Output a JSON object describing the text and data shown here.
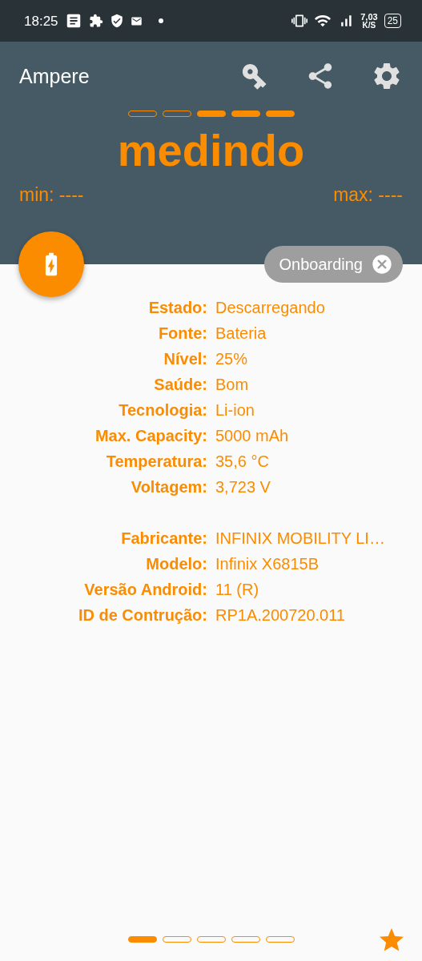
{
  "status_bar": {
    "time": "18:25",
    "speed": "7,03",
    "speed_unit": "K/S",
    "battery": "25"
  },
  "app_bar": {
    "title": "Ampere"
  },
  "meter": {
    "segments": [
      {
        "filled": false
      },
      {
        "filled": false
      },
      {
        "filled": true
      },
      {
        "filled": true
      },
      {
        "filled": true
      }
    ],
    "reading": "medindo",
    "min": "min: ----",
    "max": "max: ----"
  },
  "chip": {
    "label": "Onboarding"
  },
  "info_groups": [
    [
      {
        "label": "Estado:",
        "value": "Descarregando"
      },
      {
        "label": "Fonte:",
        "value": "Bateria"
      },
      {
        "label": "Nível:",
        "value": "25%"
      },
      {
        "label": "Saúde:",
        "value": "Bom"
      },
      {
        "label": "Tecnologia:",
        "value": "Li-ion"
      },
      {
        "label": "Max. Capacity:",
        "value": "5000 mAh"
      },
      {
        "label": "Temperatura:",
        "value": "35,6 °C"
      },
      {
        "label": "Voltagem:",
        "value": "3,723 V"
      }
    ],
    [
      {
        "label": "Fabricante:",
        "value": "INFINIX MOBILITY LI…"
      },
      {
        "label": "Modelo:",
        "value": "Infinix X6815B"
      },
      {
        "label": "Versão Android:",
        "value": "11 (R)"
      },
      {
        "label": "ID de Contrução:",
        "value": "RP1A.200720.011"
      }
    ]
  ],
  "pages": [
    {
      "selected": true
    },
    {
      "selected": false
    },
    {
      "selected": false
    },
    {
      "selected": false
    },
    {
      "selected": false
    }
  ]
}
